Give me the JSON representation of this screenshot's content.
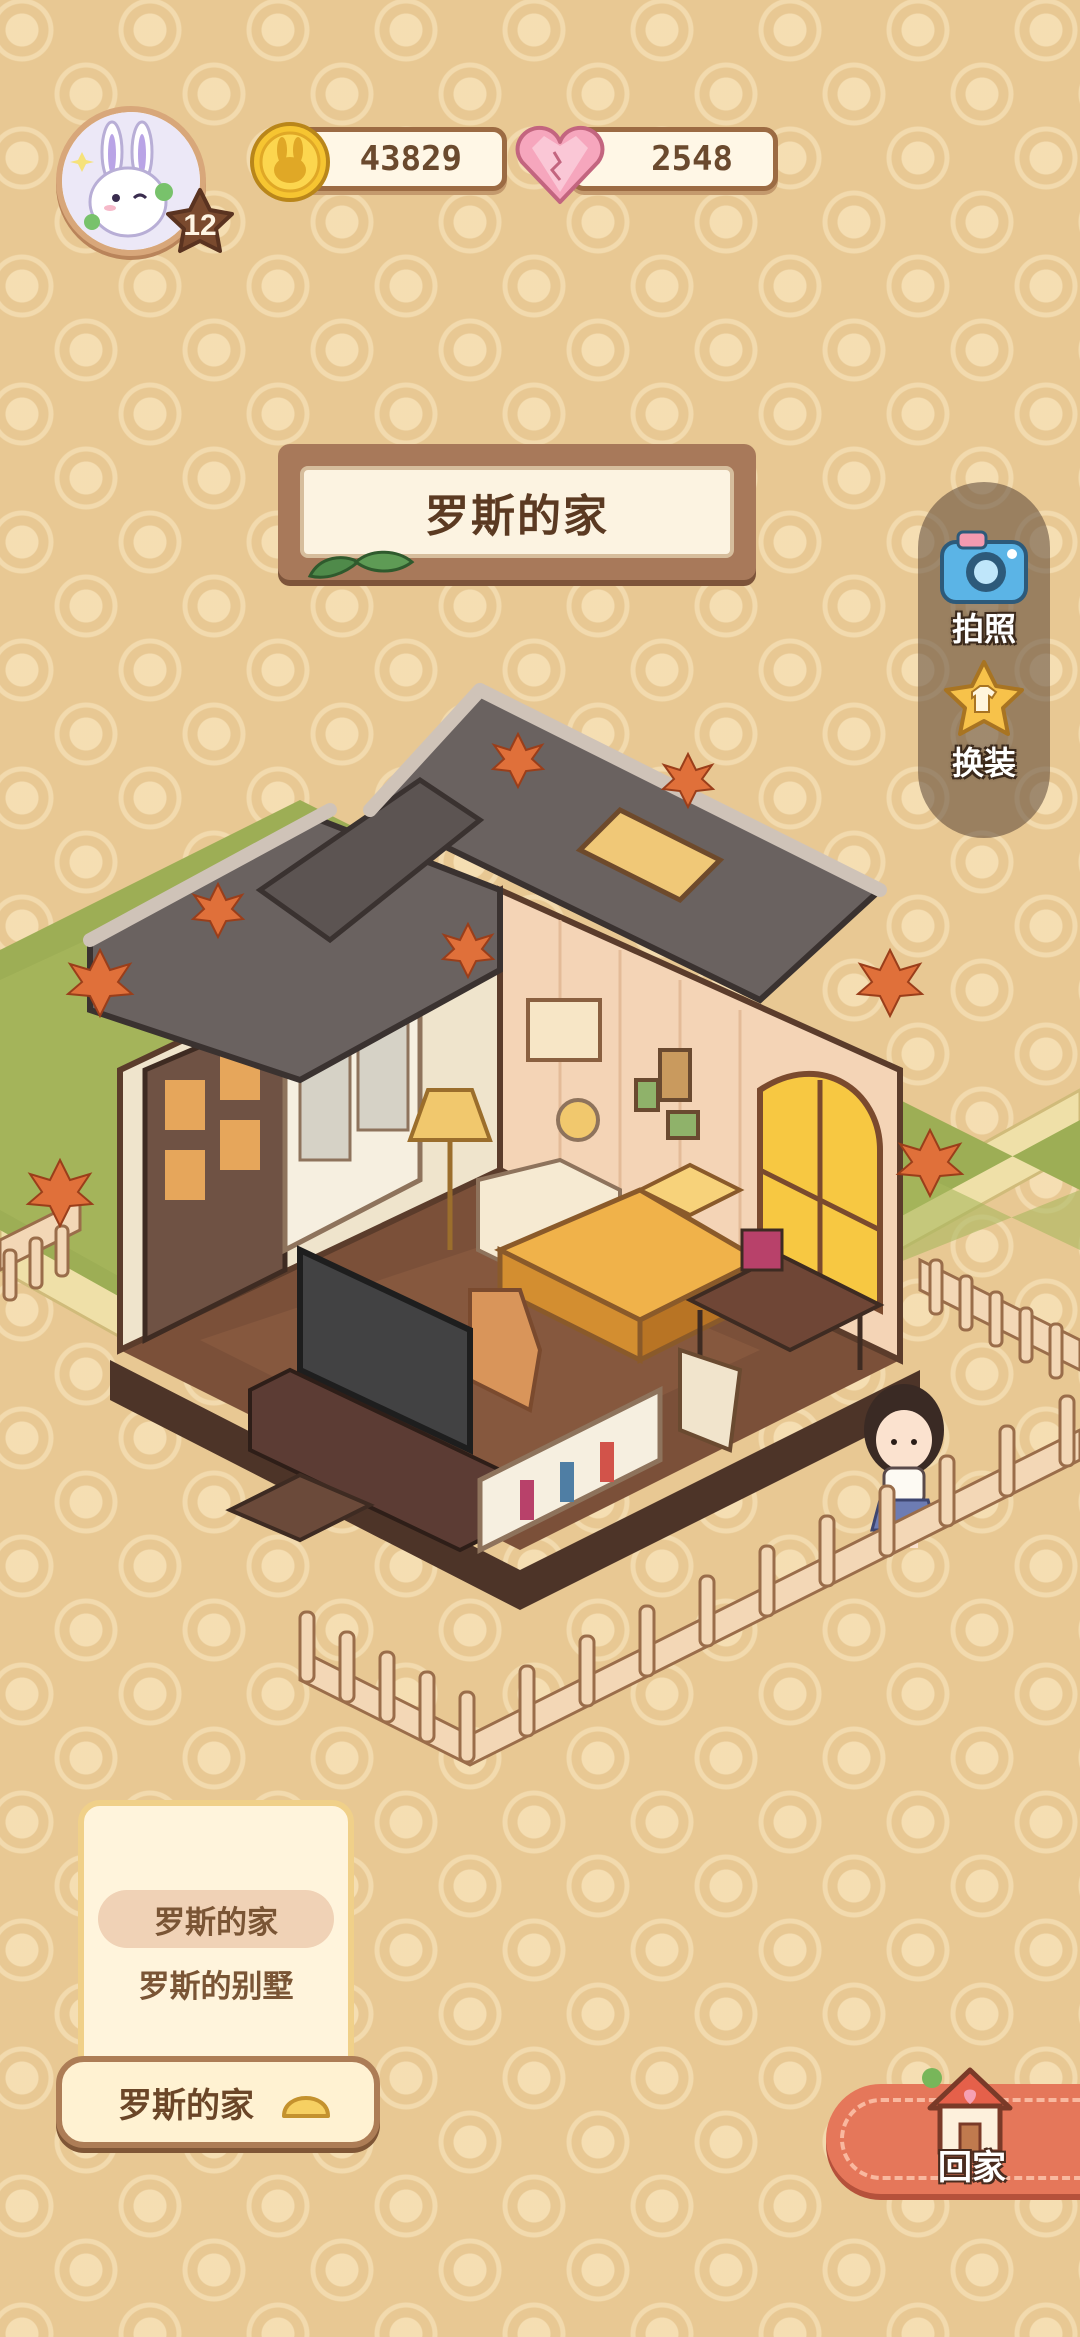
{
  "player": {
    "avatar_icon": "bunny-avatar-icon",
    "level": "12"
  },
  "currency": {
    "coins": "43829",
    "coin_icon": "rabbit-coin-icon",
    "gems": "2548",
    "gem_icon": "pink-heart-gem-icon"
  },
  "house": {
    "title": "罗斯的家"
  },
  "side_tools": [
    {
      "label": "拍照",
      "icon": "camera-icon"
    },
    {
      "label": "换装",
      "icon": "star-shirt-icon"
    }
  ],
  "house_selector": {
    "options": [
      "罗斯的家",
      "罗斯的别墅"
    ],
    "selected_index": 0,
    "current_label": "罗斯的家",
    "toggle_icon": "chevron-up-icon"
  },
  "home_button": {
    "label": "回家",
    "icon": "house-icon"
  },
  "colors": {
    "background": "#e8c893",
    "panel_border": "#a8795a",
    "home_button": "#e5775a",
    "grass": "#9dae55"
  }
}
